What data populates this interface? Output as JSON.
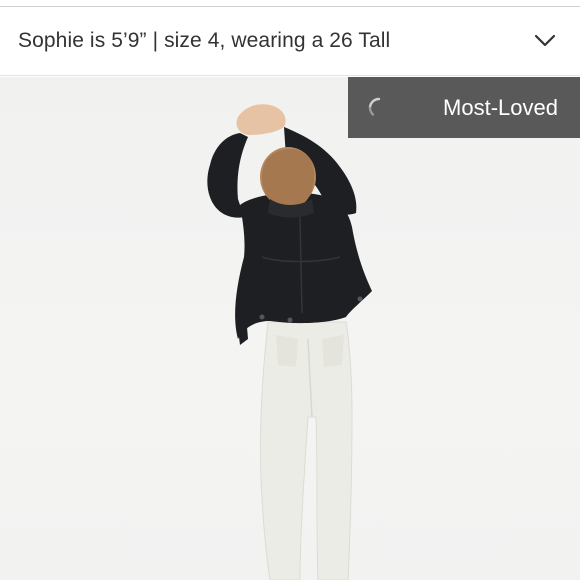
{
  "model_info": {
    "text": "Sophie is 5’9” | size 4, wearing a 26 Tall",
    "expand_icon": "chevron-down-icon"
  },
  "product_image": {
    "description_icon": "model-photo"
  },
  "badge": {
    "label": "Most-Loved",
    "icon": "loading-spinner-icon",
    "background": "#595959"
  },
  "colors": {
    "jacket": "#1e1f22",
    "jeans": "#ecece6",
    "background": "#f2f2f1"
  }
}
